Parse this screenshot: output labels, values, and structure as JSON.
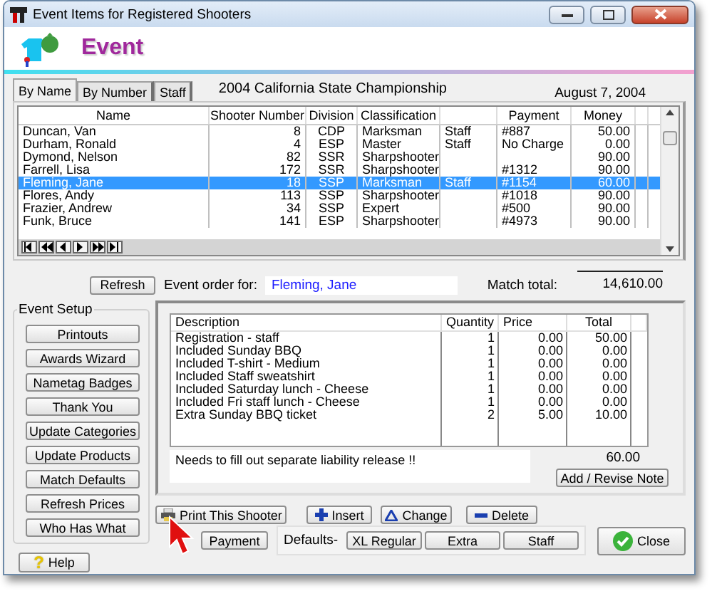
{
  "window": {
    "title": "Event Items for Registered Shooters"
  },
  "header": {
    "title": "Event"
  },
  "tabs": [
    {
      "label": "By Name",
      "selected": true
    },
    {
      "label": "By Number",
      "selected": false
    },
    {
      "label": "Staff",
      "selected": false
    }
  ],
  "event_name": "2004 California State Championship",
  "date": "August  7, 2004",
  "shooters": {
    "columns": {
      "name": "Name",
      "number": "Shooter Number",
      "division": "Division",
      "classification": "Classification",
      "payment": "Payment",
      "money": "Money"
    },
    "rows": [
      {
        "name": "Duncan, Van",
        "number": "8",
        "division": "CDP",
        "classification": "Marksman",
        "column_5": "Staff",
        "payment": "#887",
        "money": "50.00",
        "selected": false
      },
      {
        "name": "Durham, Ronald",
        "number": "4",
        "division": "ESP",
        "classification": "Master",
        "column_5": "Staff",
        "payment": "No Charge",
        "money": "0.00",
        "selected": false
      },
      {
        "name": "Dymond, Nelson",
        "number": "82",
        "division": "SSR",
        "classification": "Sharpshooter",
        "money": "90.00",
        "selected": false
      },
      {
        "name": "Farrell, Lisa",
        "number": "172",
        "division": "SSR",
        "classification": "Sharpshooter",
        "payment": "#1312",
        "money": "90.00",
        "selected": false
      },
      {
        "name": "Fleming, Jane",
        "number": "18",
        "division": "SSP",
        "classification": "Marksman",
        "column_5": "Staff",
        "payment": "#1154",
        "money": "60.00",
        "selected": true
      },
      {
        "name": "Flores, Andy",
        "number": "113",
        "division": "SSP",
        "classification": "Sharpshooter",
        "payment": "#1018",
        "money": "90.00",
        "selected": false
      },
      {
        "name": "Frazier, Andrew",
        "number": "34",
        "division": "SSP",
        "classification": "Expert",
        "payment": "#500",
        "money": "90.00",
        "selected": false
      },
      {
        "name": "Funk, Bruce",
        "number": "141",
        "division": "ESP",
        "classification": "Sharpshooter",
        "payment": "#4973",
        "money": "90.00",
        "selected": false
      }
    ]
  },
  "refresh": "Refresh",
  "event_order_label": "Event order for:",
  "shooter": "Fleming, Jane",
  "match_total_label": "Match total:",
  "match_total": "14,610.00",
  "event_setup": {
    "title": "Event Setup",
    "buttons": [
      "Printouts",
      "Awards Wizard",
      "Nametag Badges",
      "Thank You",
      "Update Categories",
      "Update Products",
      "Match Defaults",
      "Refresh Prices",
      "Who Has What"
    ]
  },
  "help": {
    "icon": "?",
    "label": "Help"
  },
  "order": {
    "columns": {
      "description": "Description",
      "quantity": "Quantity",
      "price": "Price",
      "total": "Total"
    },
    "items": [
      {
        "description": "Registration - staff",
        "quantity": "1",
        "price": "0.00",
        "total": "50.00"
      },
      {
        "description": "Included Sunday BBQ",
        "quantity": "1",
        "price": "0.00",
        "total": "0.00"
      },
      {
        "description": "Included T-shirt - Medium",
        "quantity": "1",
        "price": "0.00",
        "total": "0.00"
      },
      {
        "description": "Included Staff sweatshirt",
        "quantity": "1",
        "price": "0.00",
        "total": "0.00"
      },
      {
        "description": "Included Saturday lunch - Cheese",
        "quantity": "1",
        "price": "0.00",
        "total": "0.00"
      },
      {
        "description": "Included Fri staff lunch - Cheese",
        "quantity": "1",
        "price": "0.00",
        "total": "0.00"
      },
      {
        "description": "Extra Sunday BBQ ticket",
        "quantity": "2",
        "price": "5.00",
        "total": "10.00"
      }
    ],
    "total": "60.00",
    "note": "Needs to fill out separate liability release !!",
    "add_note": "Add / Revise Note"
  },
  "actions": {
    "print": "Print This Shooter",
    "insert": "Insert",
    "change": "Change",
    "delete": "Delete",
    "payment": "Payment",
    "defaults_label": "Defaults-",
    "defaults": [
      "XL Regular",
      "Extra",
      "Staff"
    ],
    "close": "Close"
  }
}
